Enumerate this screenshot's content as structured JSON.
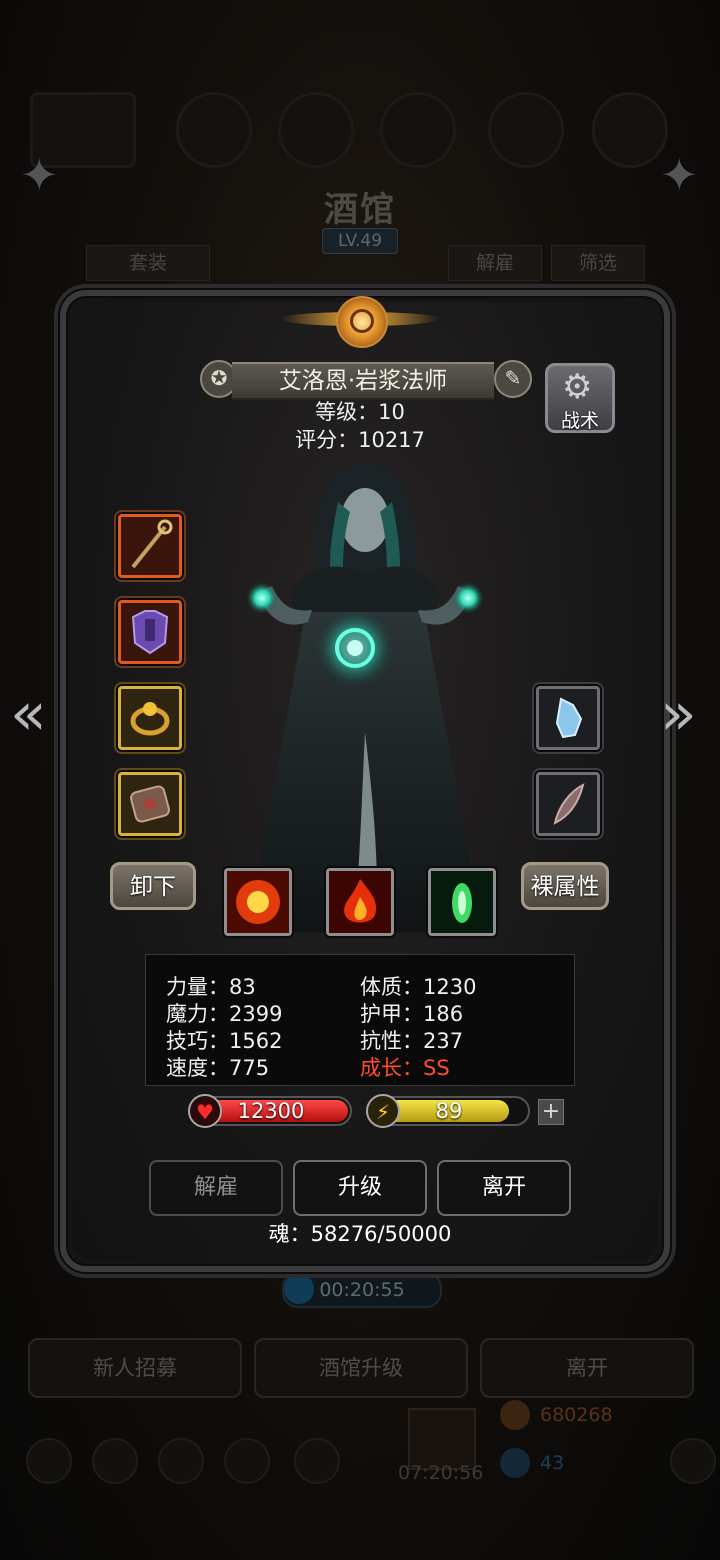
{
  "background": {
    "title": "酒馆",
    "level": "LV.49",
    "tab_left": "套装",
    "tab_dismiss": "解雇",
    "tab_filter": "筛选",
    "timer": "00:20:55",
    "btn_recruit": "新人招募",
    "btn_upgrade_tavern": "酒馆升级",
    "btn_leave": "离开",
    "gold": "680268",
    "gems": "43",
    "chest_timer": "07:20:56"
  },
  "hero": {
    "name": "艾洛恩·岩浆法师",
    "level_text": "等级：10",
    "score_text": "评分：10217",
    "tactics_label": "战术",
    "unequip_label": "卸下",
    "base_attr_label": "裸属性"
  },
  "attributes": {
    "strength": "力量：83",
    "constitution": "体质：1230",
    "magic": "魔力：2399",
    "armor": "护甲：186",
    "skill": "技巧：1562",
    "resistance": "抗性：237",
    "speed": "速度：775",
    "growth": "成长：SS"
  },
  "bars": {
    "hp": "12300",
    "hp_fill": 1.0,
    "energy": "89",
    "energy_fill": 0.89
  },
  "actions": {
    "dismiss": "解雇",
    "upgrade": "升级",
    "leave": "离开"
  },
  "soul": "魂：58276/50000",
  "icons": {
    "name_left": "medal-icon",
    "name_right": "edit-icon",
    "tactics": "gear-icon",
    "prev": "chevron-left-icon",
    "next": "chevron-right-icon",
    "hp": "heart-icon",
    "energy": "lightning-icon"
  },
  "colors": {
    "hp_bar": "#d41c1c",
    "energy_bar": "#d9c41c",
    "growth_text": "#ff4d2e"
  }
}
